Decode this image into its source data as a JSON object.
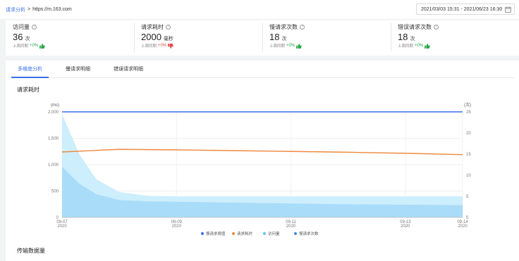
{
  "breadcrumb": {
    "parent": "请求分析",
    "separator": ">",
    "current": "https://m.163.com"
  },
  "date_range": "2021/03/03 15:31 - 2021/06/23 16:30",
  "stats": [
    {
      "title": "访问量",
      "value": "36",
      "unit": "次",
      "compare_label": "上周同期",
      "compare_value": "+0%",
      "trend": "up"
    },
    {
      "title": "请求耗时",
      "value": "2000",
      "unit": "毫秒",
      "compare_label": "上周同期",
      "compare_value": "+0%",
      "trend": "down"
    },
    {
      "title": "慢请求次数",
      "value": "18",
      "unit": "次",
      "compare_label": "上周同期",
      "compare_value": "+0%",
      "trend": "up"
    },
    {
      "title": "错误请求次数",
      "value": "18",
      "unit": "次",
      "compare_label": "上周同期",
      "compare_value": "+0%",
      "trend": "up"
    }
  ],
  "tabs": [
    {
      "label": "多维度分析",
      "active": true
    },
    {
      "label": "慢请求明细",
      "active": false
    },
    {
      "label": "错误请求明细",
      "active": false
    }
  ],
  "section_titles": {
    "duration": "请求耗时",
    "transfer": "传输数据量"
  },
  "colors": {
    "accent": "#3a6ee8",
    "up": "#27a745",
    "down": "#e24b4b"
  },
  "chart_data": {
    "type": "line",
    "left_axis_unit": "(ms)",
    "right_axis_unit": "(次)",
    "y_left_ticks": [
      "0",
      "500",
      "1,000",
      "1,500",
      "2,000"
    ],
    "y_right_ticks": [
      "0",
      "5",
      "10",
      "15",
      "20",
      "25"
    ],
    "ylim_left": [
      0,
      2000
    ],
    "ylim_right": [
      0,
      25
    ],
    "x_ticks": [
      {
        "date": "09-07",
        "year": "2020"
      },
      {
        "date": "09-09",
        "year": "2020"
      },
      {
        "date": "09-11",
        "year": "2020"
      },
      {
        "date": "09-13",
        "year": "2020"
      },
      {
        "date": "09-14",
        "year": "2020"
      }
    ],
    "x_tick_days": [
      0,
      2,
      4,
      6,
      7
    ],
    "xlim_days": [
      0,
      7
    ],
    "series": [
      {
        "name": "慢请求阈值",
        "kind": "line",
        "axis": "left",
        "color": "#3a6ee8",
        "points": [
          [
            0,
            2000
          ],
          [
            7,
            2000
          ]
        ]
      },
      {
        "name": "请求耗时",
        "kind": "line",
        "axis": "left",
        "color": "#f0883e",
        "points": [
          [
            0,
            1240
          ],
          [
            1,
            1290
          ],
          [
            2,
            1280
          ],
          [
            3,
            1265
          ],
          [
            4,
            1250
          ],
          [
            5,
            1235
          ],
          [
            6,
            1215
          ],
          [
            7,
            1190
          ]
        ]
      },
      {
        "name": "访问量",
        "kind": "area",
        "axis": "right",
        "color": "#cdeefc",
        "points": [
          [
            0,
            24.5
          ],
          [
            0.3,
            15
          ],
          [
            0.6,
            9
          ],
          [
            1,
            6
          ],
          [
            1.5,
            5.1
          ],
          [
            2,
            5
          ],
          [
            3,
            5
          ],
          [
            4,
            5
          ],
          [
            5,
            5
          ],
          [
            6,
            5
          ],
          [
            7,
            5
          ]
        ]
      },
      {
        "name": "慢请求次数",
        "kind": "area",
        "axis": "right",
        "color": "#a9dcf8",
        "points": [
          [
            0,
            12
          ],
          [
            0.3,
            8
          ],
          [
            0.6,
            5.5
          ],
          [
            1,
            4.1
          ],
          [
            1.5,
            3.8
          ],
          [
            2,
            3.7
          ],
          [
            3,
            3.5
          ],
          [
            4,
            3.3
          ],
          [
            5,
            3.1
          ],
          [
            6,
            3
          ],
          [
            7,
            2.9
          ]
        ]
      }
    ],
    "legend": [
      "慢请求阈值",
      "请求耗时",
      "访问量",
      "慢请求次数"
    ],
    "legend_position": "bottom-center",
    "grid": true
  }
}
